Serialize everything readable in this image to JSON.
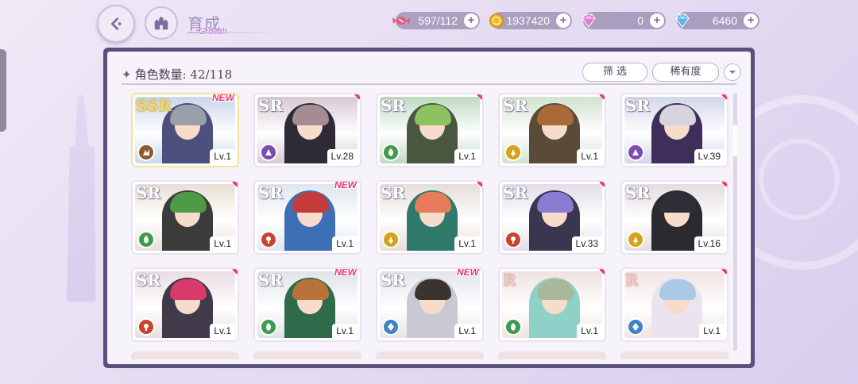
{
  "header": {
    "title": "育成",
    "title_sub": "Growth"
  },
  "resources": [
    {
      "name": "candy",
      "icon": "candy-icon",
      "value": "597/112",
      "color": "#e05a7a"
    },
    {
      "name": "gold",
      "icon": "gold-coin-icon",
      "value": "1937420",
      "color": "#f0b429"
    },
    {
      "name": "pink_gem",
      "icon": "pink-gem-icon",
      "value": "0",
      "color": "#e07ad6"
    },
    {
      "name": "blue_gem",
      "icon": "blue-gem-icon",
      "value": "6460",
      "color": "#5ab4e6"
    }
  ],
  "roster": {
    "count_label": "角色数量:",
    "count_value": "42/118",
    "filter_label": "筛 选",
    "sort_label": "稀有度"
  },
  "colors": {
    "panel_border": "#5b4f7c",
    "new_badge": "#e8386f"
  },
  "elements": {
    "earth": "#8c5a2b",
    "purple": "#7a4bb5",
    "green": "#3e9b4f",
    "yellow": "#d6a21b",
    "red": "#c8442f",
    "blue": "#3e84c6"
  },
  "cards": [
    {
      "rarity": "SSR",
      "level": "Lv.1",
      "is_new": true,
      "element": "earth",
      "sky": "#c9d7ea",
      "hair": "#9aa0aa",
      "outfit": "#4d4f7c"
    },
    {
      "rarity": "SR",
      "level": "Lv.28",
      "is_new": false,
      "element": "purple",
      "sky": "#d7c9d4",
      "hair": "#a58b92",
      "outfit": "#2f2b36"
    },
    {
      "rarity": "SR",
      "level": "Lv.1",
      "is_new": false,
      "element": "green",
      "sky": "#bfd9c2",
      "hair": "#8cc260",
      "outfit": "#4a5740"
    },
    {
      "rarity": "SR",
      "level": "Lv.1",
      "is_new": false,
      "element": "yellow",
      "sky": "#d2e2d0",
      "hair": "#a86a38",
      "outfit": "#5a4a38"
    },
    {
      "rarity": "SR",
      "level": "Lv.39",
      "is_new": false,
      "element": "purple",
      "sky": "#d3d6ea",
      "hair": "#d7d4df",
      "outfit": "#3e2f5a"
    },
    {
      "rarity": "SR",
      "level": "Lv.1",
      "is_new": false,
      "element": "green",
      "sky": "#e9dfd6",
      "hair": "#4f9a47",
      "outfit": "#3b3b3b"
    },
    {
      "rarity": "SR",
      "level": "Lv.1",
      "is_new": true,
      "element": "red",
      "sky": "#dfe6ef",
      "hair": "#c43b3b",
      "outfit": "#3d6fb5"
    },
    {
      "rarity": "SR",
      "level": "Lv.1",
      "is_new": false,
      "element": "yellow",
      "sky": "#e6ddd7",
      "hair": "#e77b5a",
      "outfit": "#2f7a6a"
    },
    {
      "rarity": "SR",
      "level": "Lv.33",
      "is_new": false,
      "element": "red",
      "sky": "#e2dde9",
      "hair": "#8a7ad0",
      "outfit": "#3a3650"
    },
    {
      "rarity": "SR",
      "level": "Lv.16",
      "is_new": false,
      "element": "yellow",
      "sky": "#e4dde0",
      "hair": "#2e2e36",
      "outfit": "#2b2b2f"
    },
    {
      "rarity": "SR",
      "level": "Lv.1",
      "is_new": false,
      "element": "red",
      "sky": "#e8dde3",
      "hair": "#d83b6b",
      "outfit": "#403a4a"
    },
    {
      "rarity": "SR",
      "level": "Lv.1",
      "is_new": true,
      "element": "green",
      "sky": "#dfe3e8",
      "hair": "#b8733a",
      "outfit": "#2f6a4a"
    },
    {
      "rarity": "SR",
      "level": "Lv.1",
      "is_new": true,
      "element": "blue",
      "sky": "#e3e5ea",
      "hair": "#3a332e",
      "outfit": "#c8c9d2"
    },
    {
      "rarity": "R",
      "level": "Lv.1",
      "is_new": false,
      "element": "green",
      "sky": "#efe2df",
      "hair": "#a9b89a",
      "outfit": "#8fd0c8"
    },
    {
      "rarity": "R",
      "level": "Lv.1",
      "is_new": false,
      "element": "blue",
      "sky": "#f0e4e2",
      "hair": "#a9c9e6",
      "outfit": "#e9e4f0"
    }
  ]
}
